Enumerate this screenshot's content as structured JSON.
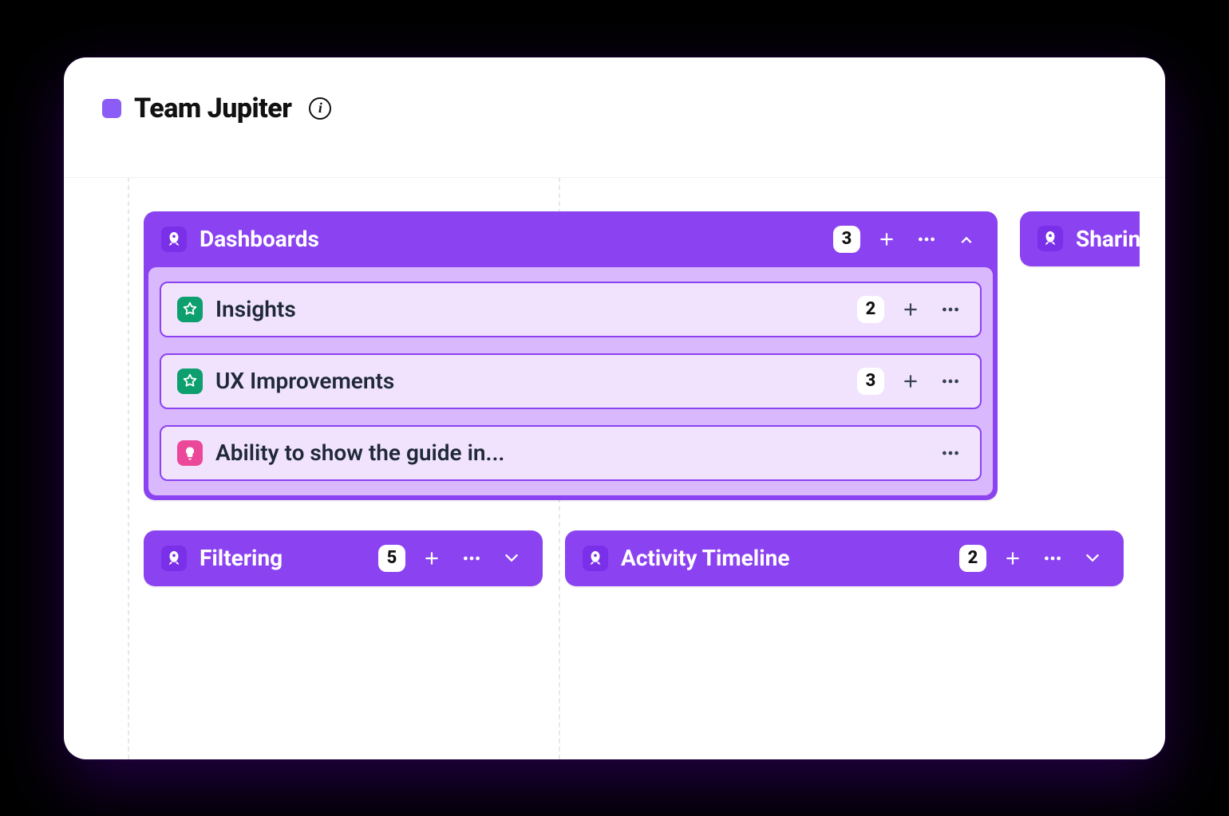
{
  "header": {
    "team_name": "Team Jupiter"
  },
  "columns": {
    "dashboards": {
      "title": "Dashboards",
      "count": "3",
      "expanded": true,
      "items": [
        {
          "icon": "star",
          "title": "Insights",
          "count": "2",
          "has_add": true,
          "has_more": true
        },
        {
          "icon": "star",
          "title": "UX Improvements",
          "count": "3",
          "has_add": true,
          "has_more": true
        },
        {
          "icon": "bulb",
          "title": "Ability to show the guide in...",
          "has_more": true
        }
      ]
    },
    "sharing": {
      "title": "Sharin"
    },
    "filtering": {
      "title": "Filtering",
      "count": "5"
    },
    "activity": {
      "title": "Activity Timeline",
      "count": "2"
    }
  }
}
